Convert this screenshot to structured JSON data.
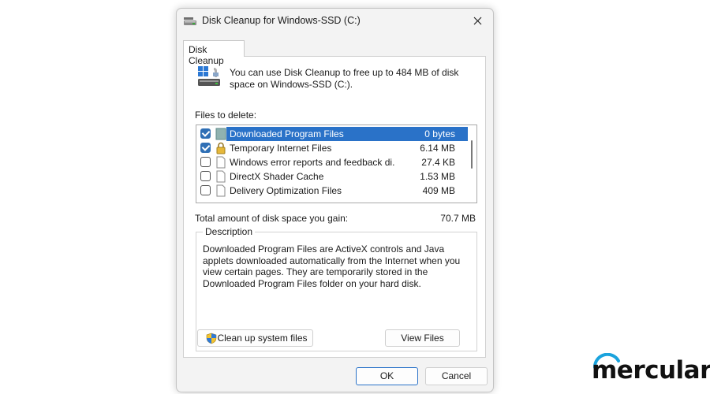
{
  "window": {
    "title": "Disk Cleanup for Windows-SSD  (C:)",
    "title_icon": "disk-cleanup-icon"
  },
  "tab": {
    "label": "Disk Cleanup"
  },
  "intro": {
    "text": "You can use Disk Cleanup to free up to 484 MB of disk space on Windows-SSD (C:).",
    "icon": "disk-cleanup-large-icon"
  },
  "files_to_delete": {
    "label": "Files to delete:",
    "items": [
      {
        "name": "Downloaded Program Files",
        "size": "0 bytes",
        "checked": true,
        "selected": true,
        "icon": "folder-icon"
      },
      {
        "name": "Temporary Internet Files",
        "size": "6.14 MB",
        "checked": true,
        "selected": false,
        "icon": "lock-icon"
      },
      {
        "name": "Windows error reports and feedback di...",
        "size": "27.4 KB",
        "checked": false,
        "selected": false,
        "icon": "file-icon"
      },
      {
        "name": "DirectX Shader Cache",
        "size": "1.53 MB",
        "checked": false,
        "selected": false,
        "icon": "file-icon"
      },
      {
        "name": "Delivery Optimization Files",
        "size": "409 MB",
        "checked": false,
        "selected": false,
        "icon": "file-icon"
      }
    ]
  },
  "total": {
    "label": "Total amount of disk space you gain:",
    "value": "70.7 MB"
  },
  "description": {
    "legend": "Description",
    "text": "Downloaded Program Files are ActiveX controls and Java applets downloaded automatically from the Internet when you view certain pages. They are temporarily stored in the Downloaded Program Files folder on your hard disk."
  },
  "buttons": {
    "cleanup_system": "Clean up system files",
    "view_files": "View Files",
    "ok": "OK",
    "cancel": "Cancel"
  },
  "brand": {
    "text": "mercular."
  },
  "colors": {
    "accent": "#2a72c8",
    "checkbox": "#2f6fb5",
    "brand_arc": "#1aa3dd"
  }
}
